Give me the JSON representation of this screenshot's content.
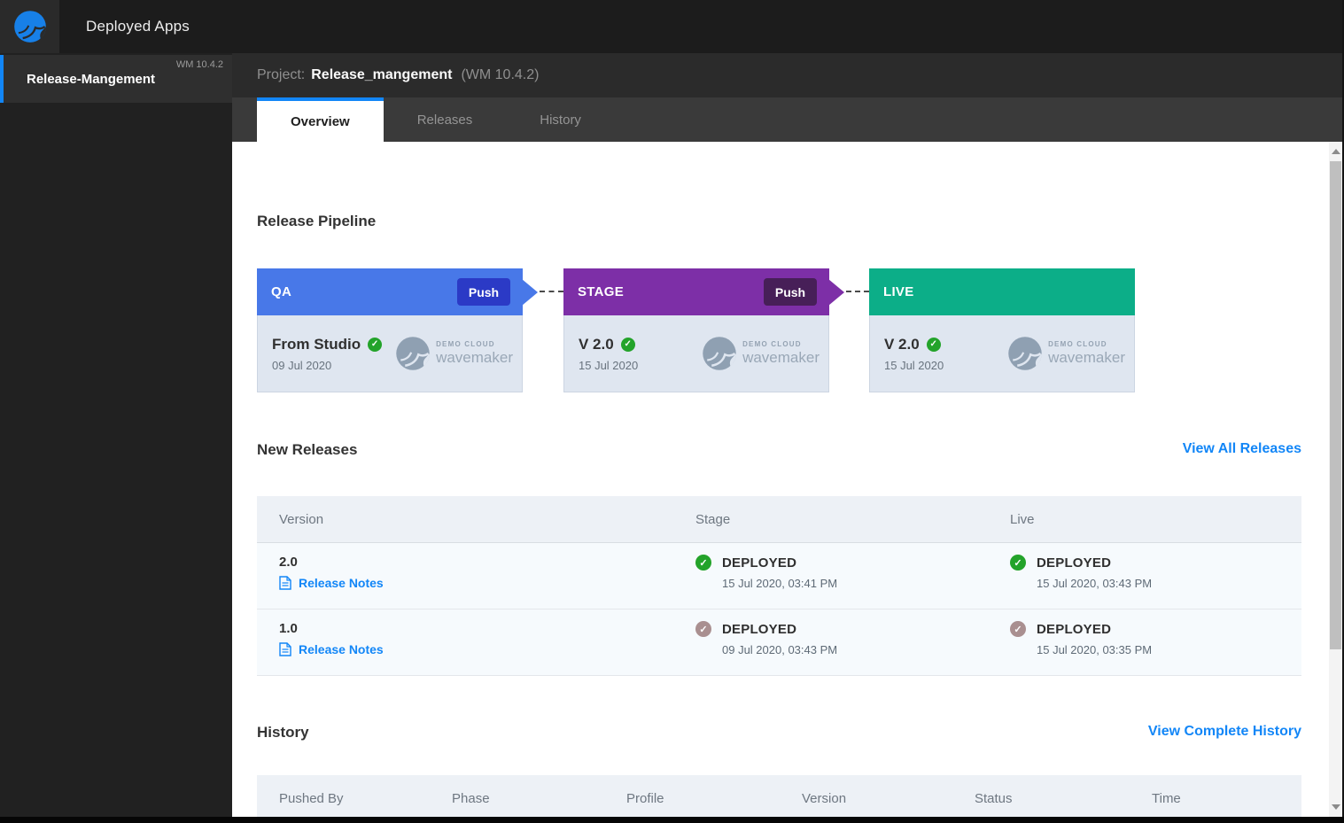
{
  "topbar": {
    "app_title": "Deployed Apps"
  },
  "sidebar": {
    "item": {
      "name": "Release-Mangement",
      "version": "WM 10.4.2"
    }
  },
  "project_header": {
    "label": "Project:",
    "name": "Release_mangement",
    "version": "(WM 10.4.2)"
  },
  "tabs": {
    "overview": "Overview",
    "releases": "Releases",
    "history": "History"
  },
  "pipeline": {
    "heading": "Release Pipeline",
    "watermark": {
      "top": "DEMO CLOUD",
      "bottom": "wavemaker"
    },
    "stages": [
      {
        "name": "QA",
        "push": "Push",
        "version": "From Studio",
        "date": "09 Jul 2020",
        "status": "success",
        "header_color": "#4878e8",
        "push_color": "#2b3ac6"
      },
      {
        "name": "STAGE",
        "push": "Push",
        "version": "V 2.0",
        "date": "15 Jul 2020",
        "status": "success",
        "header_color": "#7d2fa7",
        "push_color": "#471f58"
      },
      {
        "name": "LIVE",
        "version": "V 2.0",
        "date": "15 Jul 2020",
        "status": "success",
        "header_color": "#0cae88"
      }
    ]
  },
  "new_releases": {
    "heading": "New Releases",
    "view_all": "View All Releases",
    "columns": {
      "version": "Version",
      "stage": "Stage",
      "live": "Live"
    },
    "rows": [
      {
        "version": "2.0",
        "notes": "Release Notes",
        "stage": {
          "status": "DEPLOYED",
          "time": "15 Jul 2020, 03:41 PM",
          "badge": "green"
        },
        "live": {
          "status": "DEPLOYED",
          "time": "15 Jul 2020, 03:43 PM",
          "badge": "green"
        }
      },
      {
        "version": "1.0",
        "notes": "Release Notes",
        "stage": {
          "status": "DEPLOYED",
          "time": "09 Jul 2020, 03:43 PM",
          "badge": "muted"
        },
        "live": {
          "status": "DEPLOYED",
          "time": "15 Jul 2020, 03:35 PM",
          "badge": "muted"
        }
      }
    ]
  },
  "history": {
    "heading": "History",
    "view_all": "View Complete History",
    "columns": {
      "pushed_by": "Pushed By",
      "phase": "Phase",
      "profile": "Profile",
      "version": "Version",
      "status": "Status",
      "time": "Time"
    }
  },
  "colors": {
    "accent_blue": "#1286f7",
    "link_blue": "#1286f7",
    "qa_header": "#4878e8",
    "qa_push": "#2b3ac6",
    "stage_header": "#7d2fa7",
    "stage_push": "#471f58",
    "live_header": "#0cae88",
    "success_green": "#23a32a",
    "muted_badge": "#a98f90",
    "card_body": "#dfe6f0"
  }
}
